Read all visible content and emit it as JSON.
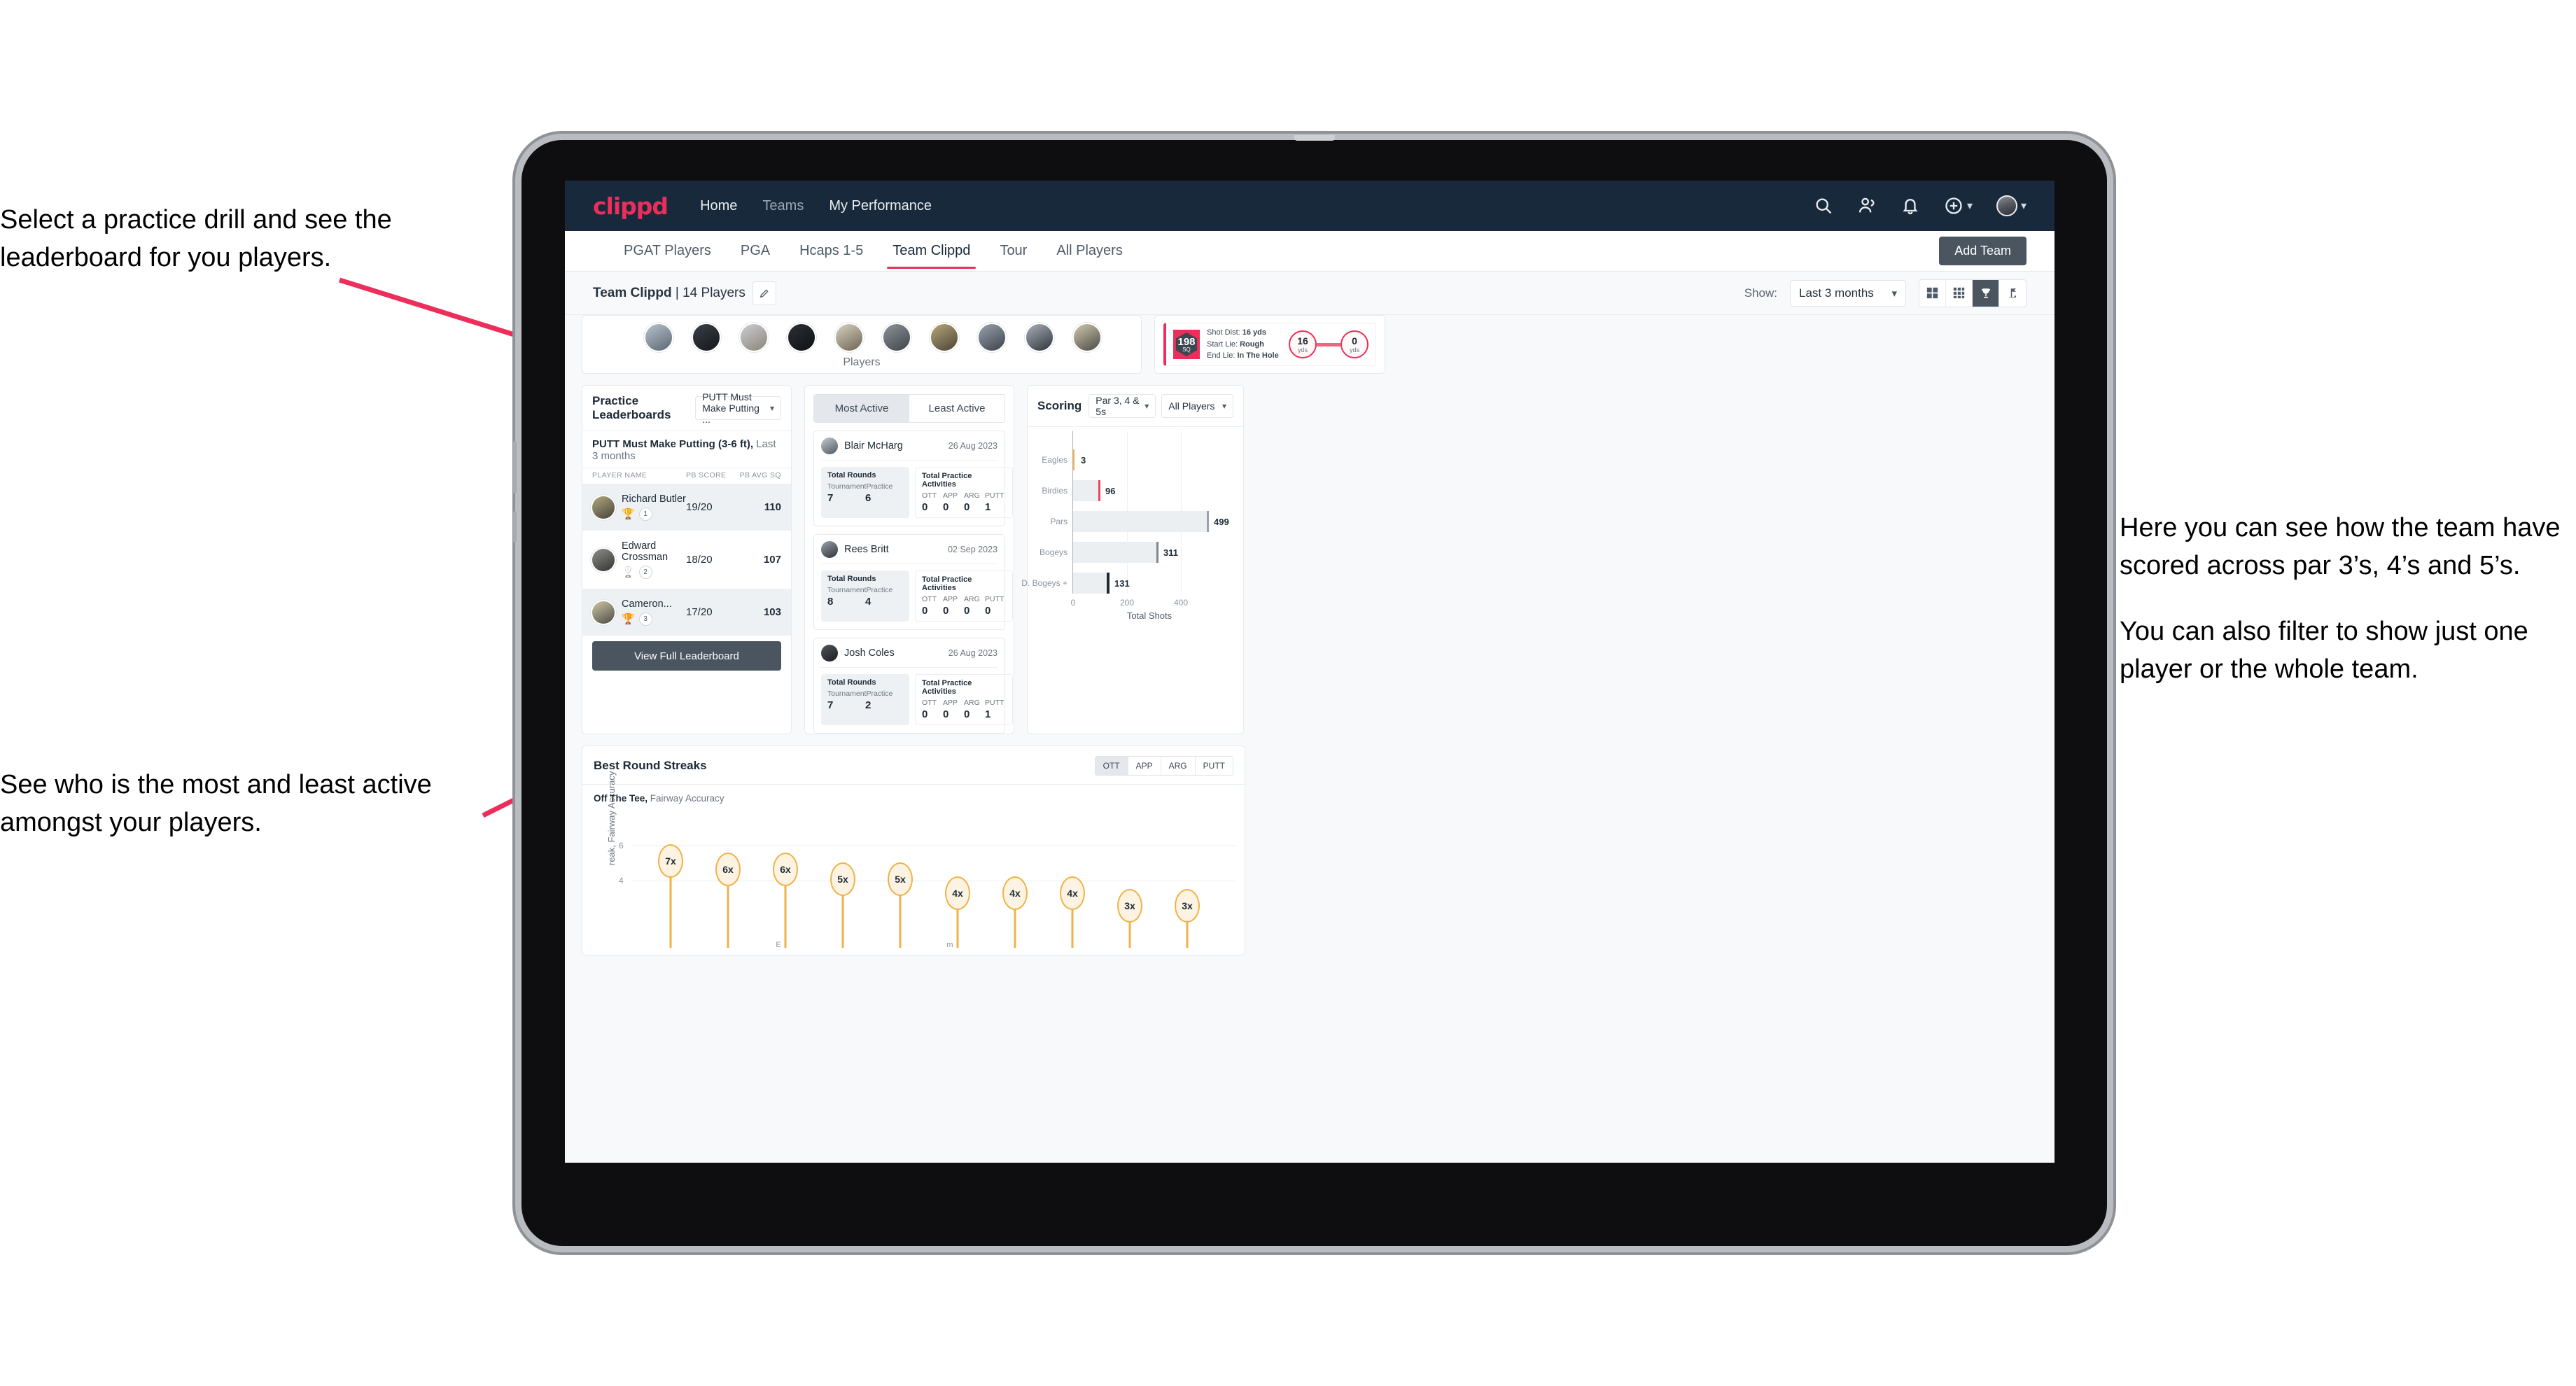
{
  "annotations": {
    "left_top": "Select a practice drill and see the leaderboard for you players.",
    "left_bottom": "See who is the most and least active amongst your players.",
    "right_1": "Here you can see how the team have scored across par 3’s, 4’s and 5’s.",
    "right_2": "You can also filter to show just one player or the whole team."
  },
  "colors": {
    "accent": "#ec2e5b",
    "navbar": "#18293b",
    "dark_button": "#4a555f",
    "gold": "#f0b248"
  },
  "navbar": {
    "brand": "clippd",
    "links": [
      {
        "label": "Home",
        "active": true
      },
      {
        "label": "Teams",
        "active": false
      },
      {
        "label": "My Performance",
        "active": false
      }
    ],
    "icons": [
      "search-icon",
      "people-icon",
      "bell-icon",
      "plus-circle-icon",
      "avatar"
    ]
  },
  "subnav": {
    "tabs": [
      {
        "label": "PGAT Players",
        "active": false
      },
      {
        "label": "PGA",
        "active": false
      },
      {
        "label": "Hcaps 1-5",
        "active": false
      },
      {
        "label": "Team Clippd",
        "active": true
      },
      {
        "label": "Tour",
        "active": false
      },
      {
        "label": "All Players",
        "active": false
      }
    ],
    "add_team_label": "Add Team"
  },
  "toolbar": {
    "team_name": "Team Clippd",
    "team_count": "| 14 Players",
    "edit_icon": "pencil-icon",
    "show_label": "Show:",
    "range_value": "Last 3 months",
    "view_icons": [
      {
        "name": "grid-large-icon",
        "active": false
      },
      {
        "name": "grid-small-icon",
        "active": false
      },
      {
        "name": "trophy-icon",
        "active": true
      },
      {
        "name": "flagstick-icon",
        "active": false
      }
    ]
  },
  "players_strip": {
    "label": "Players",
    "count": 10
  },
  "shot_card": {
    "badge_number": "198",
    "badge_unit": "SQ",
    "lines": [
      {
        "label": "Shot Dist:",
        "value": "16 yds"
      },
      {
        "label": "Start Lie:",
        "value": "Rough"
      },
      {
        "label": "End Lie:",
        "value": "In The Hole"
      }
    ],
    "start_yards": "16",
    "start_unit": "yds",
    "end_yards": "0",
    "end_unit": "yds"
  },
  "leaderboard": {
    "title": "Practice Leaderboards",
    "drill_select": "PUTT Must Make Putting ...",
    "drill_heading": "PUTT Must Make Putting (3-6 ft),",
    "drill_range": "Last 3 months",
    "columns": [
      "PLAYER NAME",
      "PB SCORE",
      "PB AVG SQ"
    ],
    "rows": [
      {
        "name": "Richard Butler",
        "rank": "1",
        "trophy": "gold",
        "score": "19/20",
        "sq": "110"
      },
      {
        "name": "Edward Crossman",
        "rank": "2",
        "trophy": "silver",
        "score": "18/20",
        "sq": "107"
      },
      {
        "name": "Cameron...",
        "rank": "3",
        "trophy": "bronze",
        "score": "17/20",
        "sq": "103"
      }
    ],
    "view_full_label": "View Full Leaderboard"
  },
  "activity": {
    "tabs": [
      {
        "label": "Most Active",
        "active": true
      },
      {
        "label": "Least Active",
        "active": false
      }
    ],
    "rounds_title": "Total Rounds",
    "rounds_labels": [
      "Tournament",
      "Practice"
    ],
    "activities_title": "Total Practice Activities",
    "activities_labels": [
      "OTT",
      "APP",
      "ARG",
      "PUTT"
    ],
    "players": [
      {
        "name": "Blair McHarg",
        "date": "26 Aug 2023",
        "rounds": [
          "7",
          "6"
        ],
        "activities": [
          "0",
          "0",
          "0",
          "1"
        ]
      },
      {
        "name": "Rees Britt",
        "date": "02 Sep 2023",
        "rounds": [
          "8",
          "4"
        ],
        "activities": [
          "0",
          "0",
          "0",
          "0"
        ]
      },
      {
        "name": "Josh Coles",
        "date": "26 Aug 2023",
        "rounds": [
          "7",
          "2"
        ],
        "activities": [
          "0",
          "0",
          "0",
          "1"
        ]
      }
    ]
  },
  "scoring": {
    "title": "Scoring",
    "par_filter": "Par 3, 4 & 5s",
    "player_filter": "All Players"
  },
  "streaks": {
    "title": "Best Round Streaks",
    "tabs": [
      {
        "label": "OTT",
        "active": true
      },
      {
        "label": "APP",
        "active": false
      },
      {
        "label": "ARG",
        "active": false
      },
      {
        "label": "PUTT",
        "active": false
      }
    ],
    "subtitle_bold": "Off The Tee,",
    "subtitle_rest": "Fairway Accuracy"
  },
  "chart_data": [
    {
      "type": "bar",
      "orientation": "horizontal",
      "title": "Scoring",
      "categories": [
        "Eagles",
        "Birdies",
        "Pars",
        "Bogeys",
        "D. Bogeys +"
      ],
      "values": [
        3,
        96,
        499,
        311,
        131
      ],
      "cap_colors": [
        "#f0b248",
        "#f0435f",
        "#9aa3ac",
        "#7d858e",
        "#1d2a36"
      ],
      "xlabel": "Total Shots",
      "ylabel": "",
      "xticks": [
        0,
        200,
        400
      ],
      "xlim": [
        0,
        560
      ],
      "grid": true,
      "legend": "none"
    },
    {
      "type": "lollipop",
      "title": "Best Round Streaks",
      "subtitle": "Off The Tee, Fairway Accuracy",
      "ylabel": "Streak, Fairway Accuracy",
      "ylabel_visible": "reak, Fairway Accuracy",
      "yticks": [
        4,
        6
      ],
      "ylim": [
        0,
        8
      ],
      "values": [
        7,
        6,
        6,
        5,
        5,
        4,
        4,
        4,
        3,
        3
      ],
      "labels": [
        "7x",
        "6x",
        "6x",
        "5x",
        "5x",
        "4x",
        "4x",
        "4x",
        "3x",
        "3x"
      ],
      "xticks_visible": [
        "E",
        "m"
      ],
      "grid": true,
      "marker_color": "#f0b248"
    }
  ]
}
